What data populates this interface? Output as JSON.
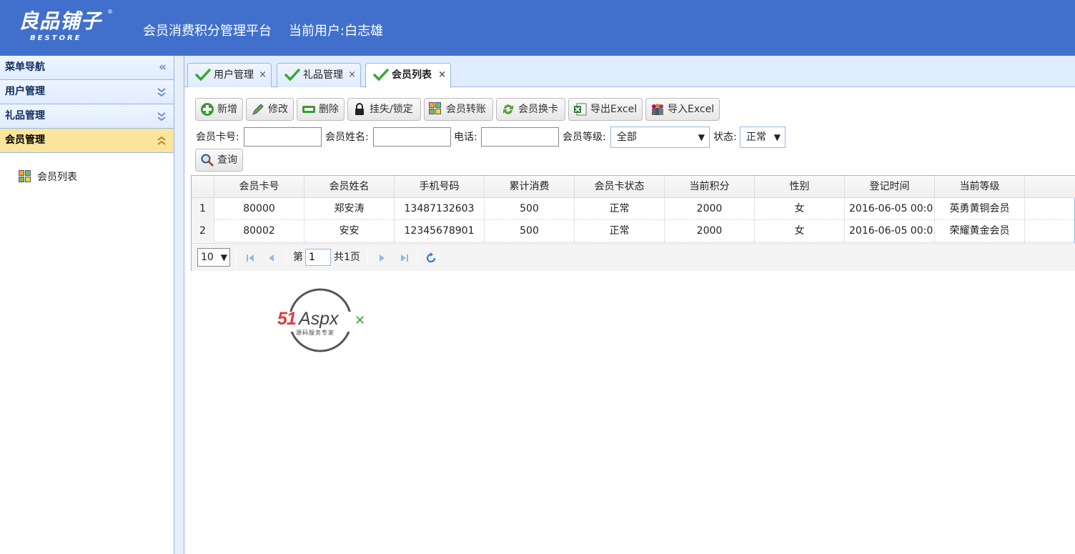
{
  "header": {
    "logo_text": "良品铺子",
    "logo_reg": "®",
    "logo_sub": "BESTORE",
    "platform_title": "会员消费积分管理平台",
    "current_user": "当前用户:白志雄"
  },
  "sidebar": {
    "nav_title": "菜单导航",
    "sections": [
      {
        "label": "用户管理"
      },
      {
        "label": "礼品管理"
      },
      {
        "label": "会员管理"
      }
    ],
    "items": [
      {
        "label": "会员列表"
      }
    ],
    "icons": [
      "double-chevron-left-icon",
      "double-chevron-down-icon",
      "double-chevron-up-icon",
      "grid-icon"
    ]
  },
  "tabs": [
    {
      "label": "用户管理",
      "close": "×"
    },
    {
      "label": "礼品管理",
      "close": "×"
    },
    {
      "label": "会员列表",
      "close": "×"
    }
  ],
  "toolbar": {
    "add": "新增",
    "edit": "修改",
    "delete": "删除",
    "lock": "挂失/锁定",
    "transfer": "会员转账",
    "swap_card": "会员换卡",
    "export": "导出Excel",
    "import": "导入Excel"
  },
  "search": {
    "card_label": "会员卡号:",
    "card_value": "",
    "name_label": "会员姓名:",
    "name_value": "",
    "phone_label": "电话:",
    "phone_value": "",
    "level_label": "会员等级:",
    "level_value": "全部",
    "status_label": "状态:",
    "status_value": "正常",
    "query_button": "查询"
  },
  "grid": {
    "columns": [
      "会员卡号",
      "会员姓名",
      "手机号码",
      "累计消费",
      "会员卡状态",
      "当前积分",
      "性别",
      "登记时间",
      "当前等级"
    ],
    "rows": [
      {
        "rownum": "1",
        "card": "80000",
        "name": "郑安涛",
        "phone": "13487132603",
        "spend": "500",
        "status": "正常",
        "points": "2000",
        "gender": "女",
        "time": "2016-06-05 00:0",
        "level": "英勇黄铜会员"
      },
      {
        "rownum": "2",
        "card": "80002",
        "name": "安安",
        "phone": "12345678901",
        "spend": "500",
        "status": "正常",
        "points": "2000",
        "gender": "女",
        "time": "2016-06-05 00:0",
        "level": "荣耀黄金会员"
      }
    ]
  },
  "pager": {
    "page_size": "10",
    "page_prefix": "第",
    "page_value": "1",
    "total": "共1页"
  },
  "watermark": {
    "brand_51": "51",
    "brand_aspx": "Aspx",
    "tagline": "源码服务专家"
  },
  "colors": {
    "header_bg": "#4170cc",
    "active_section": "#fbe59a",
    "border": "#95b8e7"
  }
}
